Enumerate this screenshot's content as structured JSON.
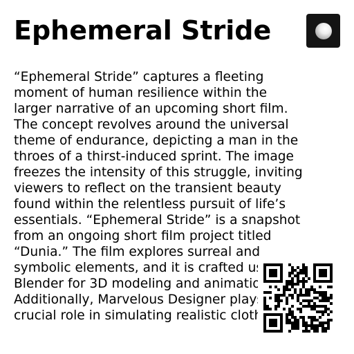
{
  "header": {
    "title": "Ephemeral Stride",
    "logo_icon": "white-sphere-icon"
  },
  "body": {
    "description": "“Ephemeral Stride” captures a fleeting moment of human resilience within the larger narrative of an upcoming short film. The concept revolves around the universal theme of endurance, depicting a man in the throes of a thirst-induced sprint. The image freezes the intensity of this struggle, inviting viewers to reflect on the transient beauty found within the relentless pursuit of life’s essentials. “Ephemeral Stride” is a snapshot from an ongoing short film project titled “Dunia.” The film explores surreal and symbolic elements, and it is crafted using Blender for 3D modeling and animation. Additionally, Marvelous Designer plays a crucial role in simulating realistic clothing"
  },
  "qr": {
    "icon": "qr-code-icon"
  }
}
